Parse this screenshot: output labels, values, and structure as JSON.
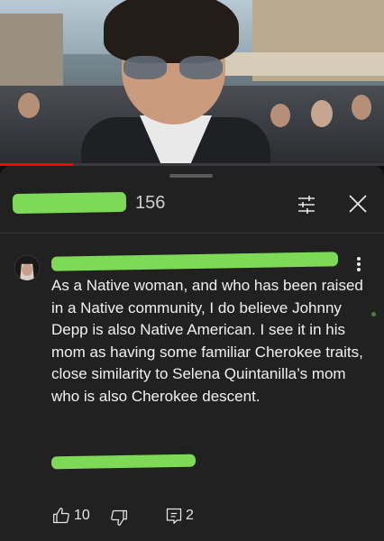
{
  "video": {
    "progress_fraction": 0.19
  },
  "comments_panel": {
    "comment_count": "156",
    "filter_icon": "sliders-icon",
    "close_icon": "close-icon"
  },
  "comment": {
    "text": "As a Native woman, and who has been raised in a Native community, I do believe Johnny Depp is also Native American. I see it in his mom as having some familiar Cherokee traits, close similarity to Selena Quintanilla’s mom who is also Cherokee descent.",
    "likes": "10",
    "replies": "2"
  },
  "colors": {
    "background": "#0f0f0f",
    "sheet": "#212121",
    "progress": "#ff0000",
    "redaction": "#7ed957"
  }
}
